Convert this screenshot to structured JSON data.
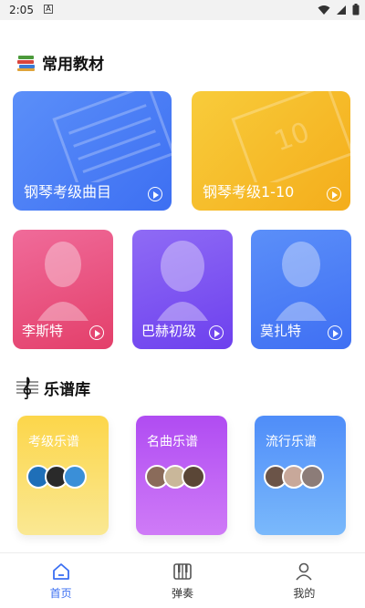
{
  "status_bar": {
    "time": "2:05",
    "notice_icon": "A"
  },
  "sections": {
    "textbooks": {
      "title": "常用教材",
      "icon": "books-icon"
    },
    "library": {
      "title": "乐谱库",
      "icon": "treble-clef-icon"
    }
  },
  "textbooks": [
    {
      "label": "钢琴考级曲目"
    },
    {
      "label": "钢琴考级1-10"
    }
  ],
  "composers": [
    {
      "label": "李斯特"
    },
    {
      "label": "巴赫初级"
    },
    {
      "label": "莫扎特"
    }
  ],
  "library": [
    {
      "label": "考级乐谱"
    },
    {
      "label": "名曲乐谱"
    },
    {
      "label": "流行乐谱"
    }
  ],
  "tabs": [
    {
      "label": "首页",
      "icon": "home-icon",
      "active": true
    },
    {
      "label": "弹奏",
      "icon": "piano-icon",
      "active": false
    },
    {
      "label": "我的",
      "icon": "user-icon",
      "active": false
    }
  ],
  "colors": {
    "accent": "#3b6ff2",
    "card_blue": "#4a7ef6",
    "card_yellow": "#f6bd2a",
    "card_pink": "#ea5580",
    "card_purple": "#7c55f2",
    "lib_yellow": "#fcd64a",
    "lib_purple": "#c066f5",
    "lib_blue": "#5f9df9"
  }
}
